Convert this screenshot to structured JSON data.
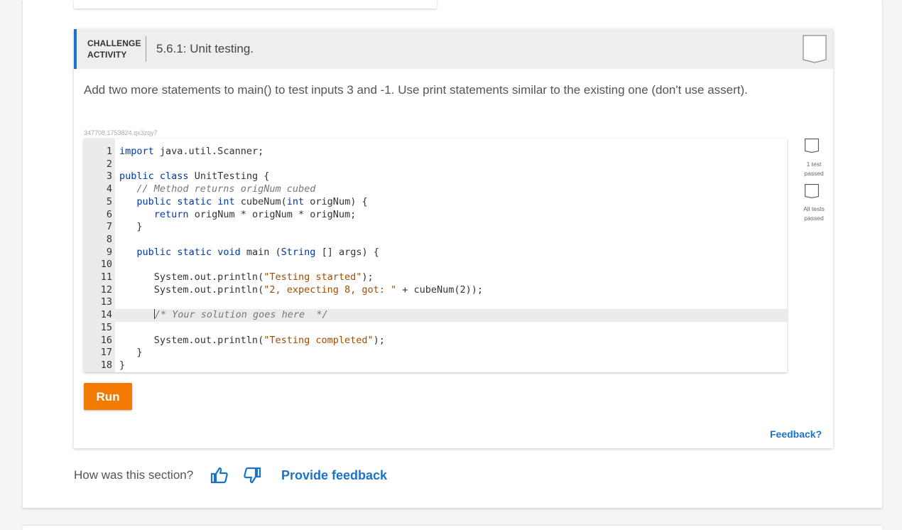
{
  "challenge": {
    "type_label_line1": "CHALLENGE",
    "type_label_line2": "ACTIVITY",
    "title": "5.6.1: Unit testing.",
    "instructions": "Add two more statements to main() to test inputs 3 and -1. Use print statements similar to the existing one (don't use assert).",
    "code_id": "347708.1753824.qx3zqy7"
  },
  "editor": {
    "active_line": 14,
    "lines": [
      {
        "n": "1",
        "text": "import java.util.Scanner;"
      },
      {
        "n": "2",
        "text": ""
      },
      {
        "n": "3",
        "text": "public class UnitTesting {"
      },
      {
        "n": "4",
        "text": "   // Method returns origNum cubed"
      },
      {
        "n": "5",
        "text": "   public static int cubeNum(int origNum) {"
      },
      {
        "n": "6",
        "text": "      return origNum * origNum * origNum;"
      },
      {
        "n": "7",
        "text": "   }"
      },
      {
        "n": "8",
        "text": ""
      },
      {
        "n": "9",
        "text": "   public static void main (String [] args) {"
      },
      {
        "n": "10",
        "text": ""
      },
      {
        "n": "11",
        "text": "      System.out.println(\"Testing started\");"
      },
      {
        "n": "12",
        "text": "      System.out.println(\"2, expecting 8, got: \" + cubeNum(2));"
      },
      {
        "n": "13",
        "text": ""
      },
      {
        "n": "14",
        "text": "      /* Your solution goes here  */"
      },
      {
        "n": "15",
        "text": ""
      },
      {
        "n": "16",
        "text": "      System.out.println(\"Testing completed\");"
      },
      {
        "n": "17",
        "text": "   }"
      },
      {
        "n": "18",
        "text": "}"
      }
    ]
  },
  "status": {
    "test1_line1": "1 test",
    "test1_line2": "passed",
    "all_line1": "All tests",
    "all_line2": "passed"
  },
  "actions": {
    "run_label": "Run",
    "feedback_label": "Feedback?"
  },
  "section_feedback": {
    "question": "How was this section?",
    "provide_label": "Provide feedback",
    "thumb_up_icon": "thumbs-up-icon",
    "thumb_down_icon": "thumbs-down-icon"
  },
  "colors": {
    "accent": "#1a73c8",
    "run_button": "#f27a00",
    "keyword": "#0039a6",
    "string": "#a34b00"
  }
}
